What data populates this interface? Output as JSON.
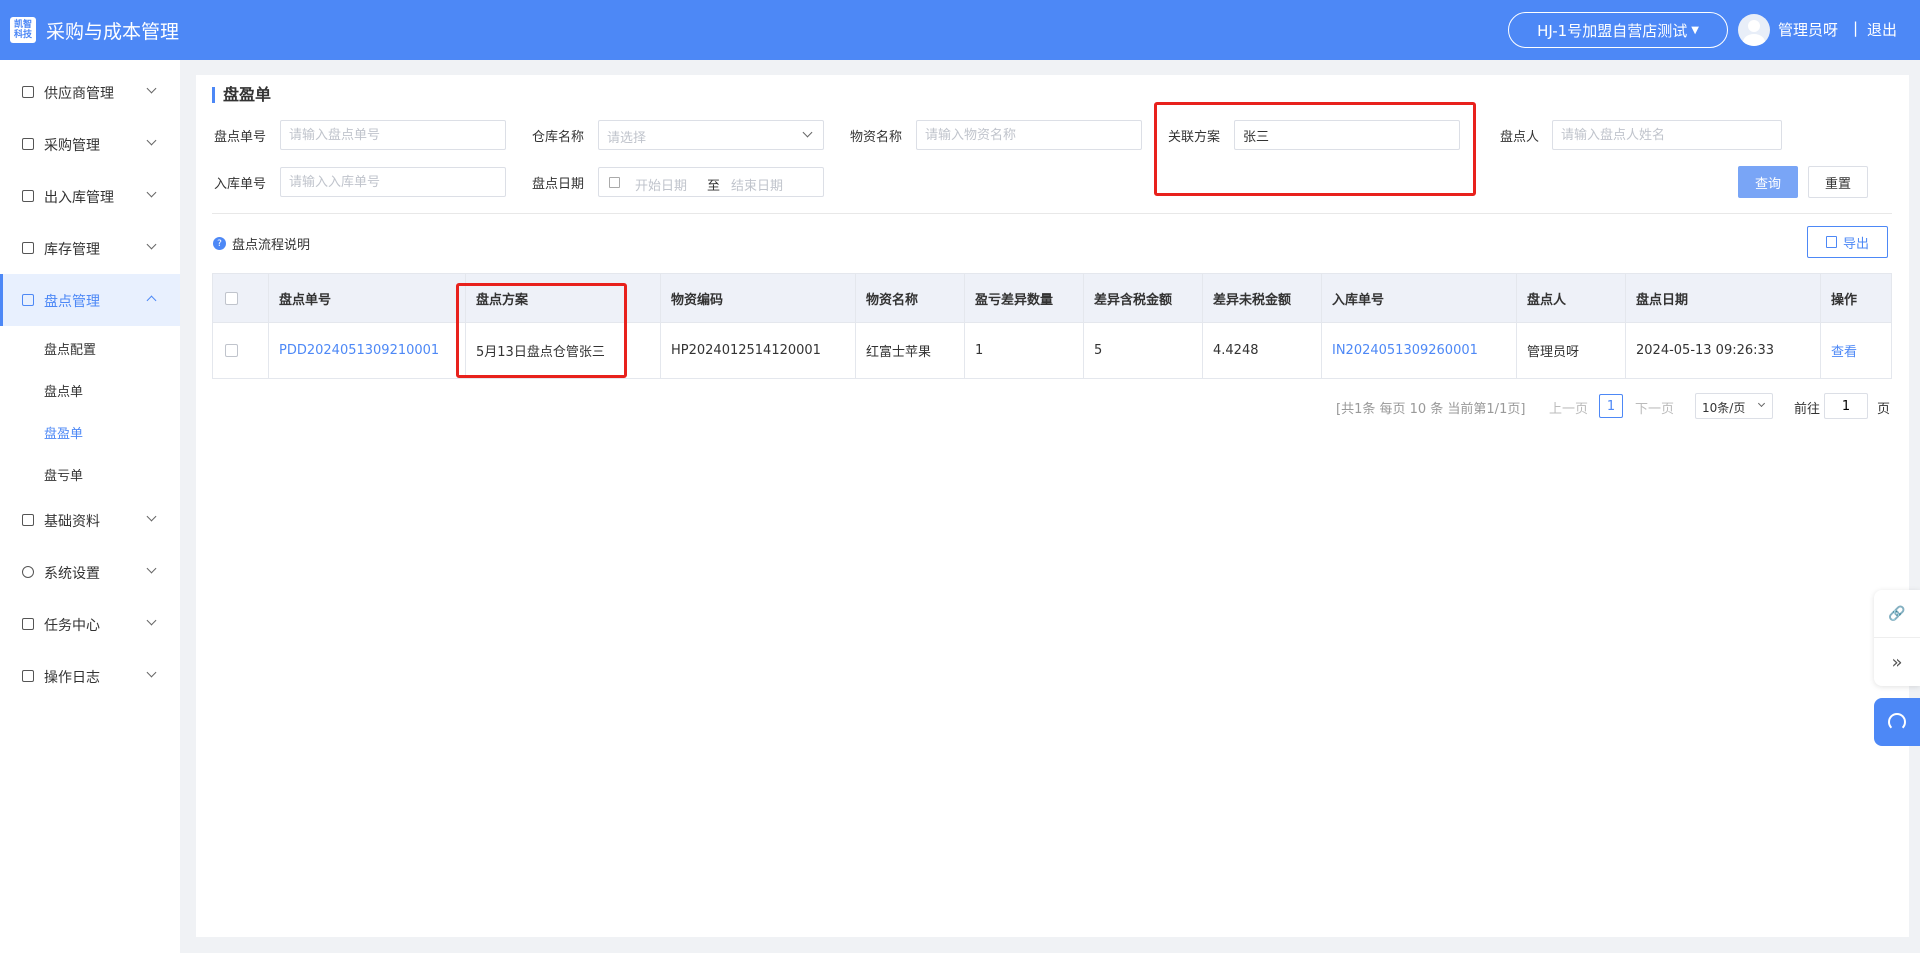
{
  "header": {
    "logo_line1": "凯智",
    "logo_line2": "科技",
    "title": "采购与成本管理",
    "store": "HJ-1号加盟自营店测试",
    "user": "管理员呀",
    "separator": "|",
    "logout": "退出"
  },
  "sidebar": {
    "items": [
      {
        "label": "供应商管理"
      },
      {
        "label": "采购管理"
      },
      {
        "label": "出入库管理"
      },
      {
        "label": "库存管理"
      },
      {
        "label": "盘点管理"
      },
      {
        "label": "基础资料"
      },
      {
        "label": "系统设置"
      },
      {
        "label": "任务中心"
      },
      {
        "label": "操作日志"
      }
    ],
    "sub_items": [
      {
        "label": "盘点配置"
      },
      {
        "label": "盘点单"
      },
      {
        "label": "盘盈单"
      },
      {
        "label": "盘亏单"
      }
    ]
  },
  "page": {
    "title": "盘盈单",
    "help": "盘点流程说明",
    "help_icon": "?"
  },
  "filters": {
    "check_no_label": "盘点单号",
    "check_no_placeholder": "请输入盘点单号",
    "warehouse_label": "仓库名称",
    "warehouse_placeholder": "请选择",
    "material_label": "物资名称",
    "material_placeholder": "请输入物资名称",
    "plan_label": "关联方案",
    "plan_value": "张三",
    "checker_label": "盘点人",
    "checker_placeholder": "请输入盘点人姓名",
    "inbound_label": "入库单号",
    "inbound_placeholder": "请输入入库单号",
    "date_label": "盘点日期",
    "date_start": "开始日期",
    "date_to": "至",
    "date_end": "结束日期"
  },
  "buttons": {
    "query": "查询",
    "reset": "重置",
    "export": "导出"
  },
  "table": {
    "headers": [
      "盘点单号",
      "盘点方案",
      "物资编码",
      "物资名称",
      "盈亏差异数量",
      "差异含税金额",
      "差异未税金额",
      "入库单号",
      "盘点人",
      "盘点日期",
      "操作"
    ],
    "rows": [
      {
        "check_no": "PDD2024051309210001",
        "plan": "5月13日盘点仓管张三",
        "material_code": "HP2024012514120001",
        "material_name": "红富士苹果",
        "diff_qty": "1",
        "diff_tax_amount": "5",
        "diff_untaxed_amount": "4.4248",
        "inbound_no": "IN2024051309260001",
        "checker": "管理员呀",
        "date": "2024-05-13 09:26:33",
        "action": "查看"
      }
    ]
  },
  "pagination": {
    "summary": "[共1条 每页 10 条 当前第1/1页]",
    "prev": "上一页",
    "current": "1",
    "next": "下一页",
    "page_size": "10条/页",
    "goto": "前往",
    "goto_value": "1",
    "unit": "页"
  },
  "float": {
    "link_icon": "link-icon",
    "expand_icon": "double-chevron-right-icon",
    "service_icon": "headset-icon"
  },
  "colors": {
    "primary": "#4d88f6",
    "highlight": "#e8211c"
  }
}
